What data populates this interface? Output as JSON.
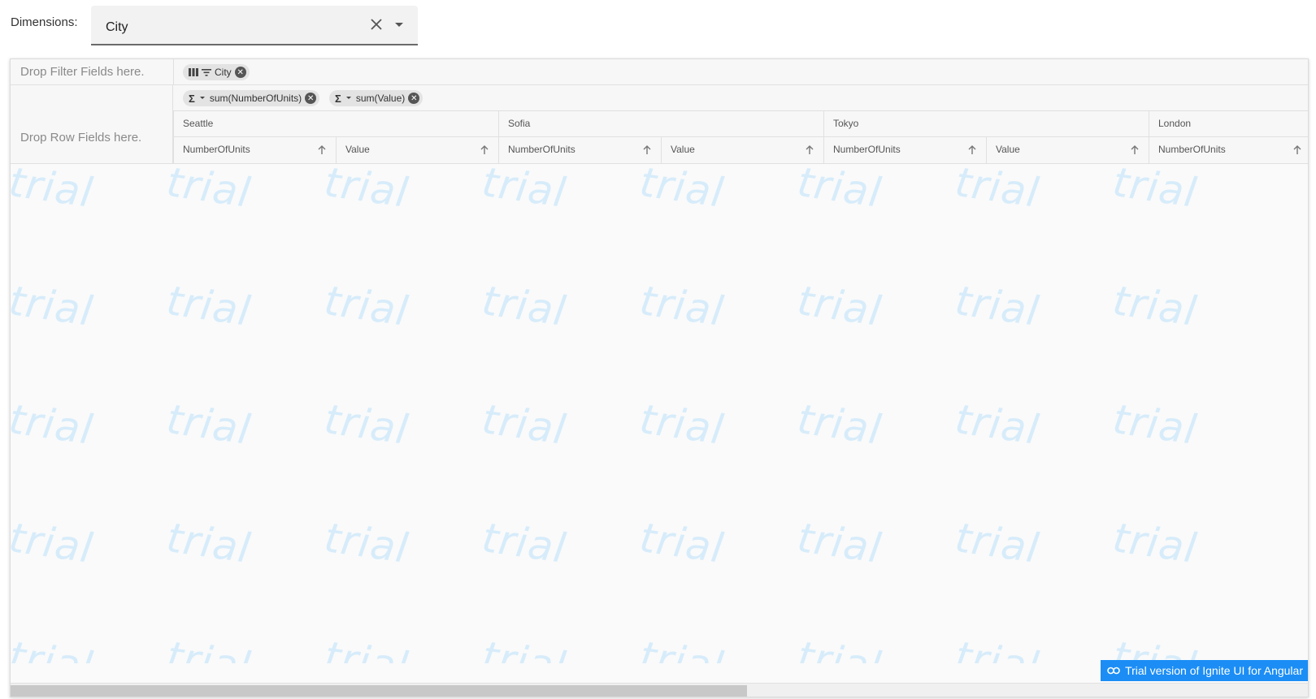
{
  "dimensions": {
    "label": "Dimensions:",
    "selected": "City"
  },
  "pivot": {
    "filter_area": {
      "placeholder": "Drop Filter Fields here.",
      "chips": [
        {
          "label": "City"
        }
      ]
    },
    "row_area": {
      "placeholder": "Drop Row Fields here."
    },
    "values_area": {
      "chips": [
        {
          "label": "sum(NumberOfUnits)"
        },
        {
          "label": "sum(Value)"
        }
      ]
    },
    "column_groups": [
      {
        "label": "Seattle",
        "columns": [
          {
            "label": "NumberOfUnits"
          },
          {
            "label": "Value"
          }
        ]
      },
      {
        "label": "Sofia",
        "columns": [
          {
            "label": "NumberOfUnits"
          },
          {
            "label": "Value"
          }
        ]
      },
      {
        "label": "Tokyo",
        "columns": [
          {
            "label": "NumberOfUnits"
          },
          {
            "label": "Value"
          }
        ]
      },
      {
        "label": "London",
        "columns": [
          {
            "label": "NumberOfUnits"
          }
        ]
      }
    ],
    "watermark_text": "trial",
    "trial_badge": "Trial version of Ignite UI for Angular"
  },
  "colors": {
    "accent": "#1b8df5",
    "watermark": "#d7ecfa"
  }
}
